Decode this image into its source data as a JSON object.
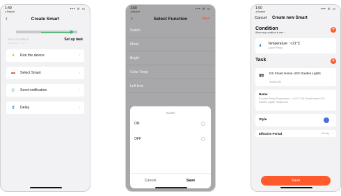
{
  "status_bar": {
    "time1": "1:49",
    "time2": "1:50",
    "time3": "1:50",
    "back_app": "◂ Search",
    "system_icons": "▪▪▪ ≋ ▭"
  },
  "screen1": {
    "title": "Create Smart",
    "step1_label": "Set a condition",
    "step1_sub": "Temperature : <21°C",
    "step2_label": "Set up task",
    "options": [
      {
        "label": "Run the device",
        "icon": "hand-tap-icon",
        "color": "#f5a623"
      },
      {
        "label": "Select Smart",
        "icon": "scene-icon",
        "color": "#e8533a"
      },
      {
        "label": "Send notification",
        "icon": "notification-icon",
        "color": "#3bb36a"
      },
      {
        "label": "Delay",
        "icon": "hourglass-icon",
        "color": "#3a7bd5"
      }
    ]
  },
  "screen2": {
    "title": "Select Function",
    "next": "Next",
    "functions": [
      "Switch",
      "Mode",
      "Bright",
      "Color Temp",
      "Left time"
    ],
    "sheet_title": "Switch",
    "choices": [
      "ON",
      "OFF"
    ],
    "cancel": "Cancel",
    "save": "Save"
  },
  "screen3": {
    "cancel": "Cancel",
    "title": "Create new Smart",
    "condition_heading": "Condition",
    "condition_sub_prefix": "When any condition is met",
    "condition_sub_suffix": "›",
    "condition_item": "Temperature : <21°C",
    "condition_item_sub": "Lower Plenty",
    "task_heading": "Task",
    "task_brand": "ffff",
    "task_item": "NX Smart Home LED Garden Lights",
    "task_item_sub": "Switch:ON",
    "name_label": "Name",
    "name_value": "If Lower Plenty Temperature : <21°C,\"NX Smart Home LED Garden Lights\" Switch:ON",
    "style_label": "Style",
    "style_color": "#4a6fd8",
    "effective_label": "Effective Period",
    "effective_value": "All day",
    "save_button": "Save"
  },
  "accent": "#ff5a2c"
}
